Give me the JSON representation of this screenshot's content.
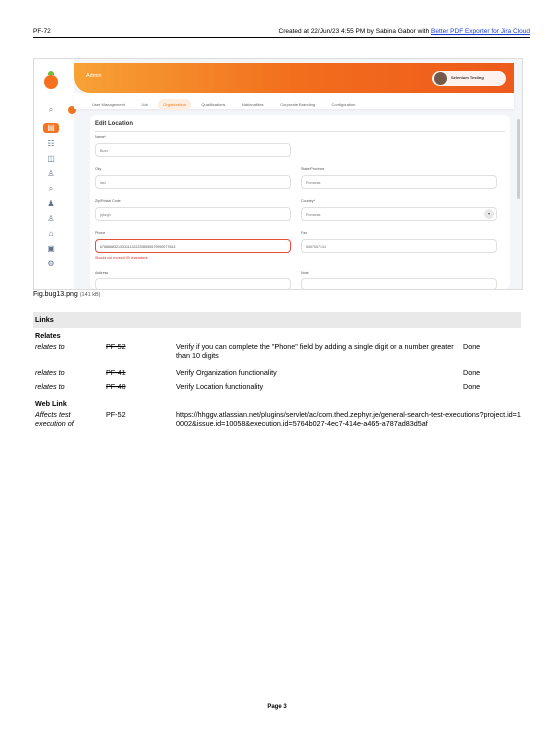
{
  "header": {
    "issue_key": "PF-72",
    "created_text": "Created at 22/Jun/23 4:55 PM by Sabina Gabor with ",
    "exporter_link": "Better PDF Exporter for Jira Cloud"
  },
  "screenshot": {
    "topbar_title": "Admin",
    "profile_name": "Selenium Testing",
    "nav": [
      "User Management",
      "Job",
      "Organization",
      "Qualifications",
      "Nationalities",
      "Corporate Branding",
      "Configuration"
    ],
    "form_title": "Edit Location",
    "fields": {
      "name_label": "Name*",
      "name_value": "Buzz",
      "city_label": "City",
      "city_value": "Iasi",
      "state_label": "State/Province",
      "state_value": "Romania",
      "zip_label": "Zip/Postal Code",
      "zip_value": "jqhzgh",
      "country_label": "Country*",
      "country_value": "Romania",
      "phone_label": "Phone",
      "phone_value": "67886683213331113222335555579990077643",
      "fax_label": "Fax",
      "fax_value": "8687687134",
      "error": "Should not exceed 30 characters",
      "address_label": "Address",
      "note_label": "Note"
    }
  },
  "attachment": {
    "name": "Fig.bug13.png",
    "size": "(141 kB)"
  },
  "links": {
    "section_title": "Links",
    "relates_title": "Relates",
    "relates": [
      {
        "type": "relates to",
        "key": "PF-52",
        "summary": "Verify if you can complete the \"Phone\" field by adding a single digit or a number greater than 10 digits",
        "status": "Done"
      },
      {
        "type": "relates to",
        "key": "PF-41",
        "summary": "Verify Organization functionality",
        "status": "Done"
      },
      {
        "type": "relates to",
        "key": "PF-40",
        "summary": "Verify Location functionality",
        "status": "Done"
      }
    ],
    "weblink_title": "Web Link",
    "weblink": {
      "type": "Affects test execution of",
      "key": "PF-52",
      "url": "https://hhggv.atlassian.net/plugins/servlet/ac/com.thed.zephyr.je/general-search-test-executions?project.id=10002&issue.id=10058&execution.id=5764b027-4ec7-414e-a465-a787ad83d5af"
    }
  },
  "footer": {
    "page": "Page 3"
  }
}
